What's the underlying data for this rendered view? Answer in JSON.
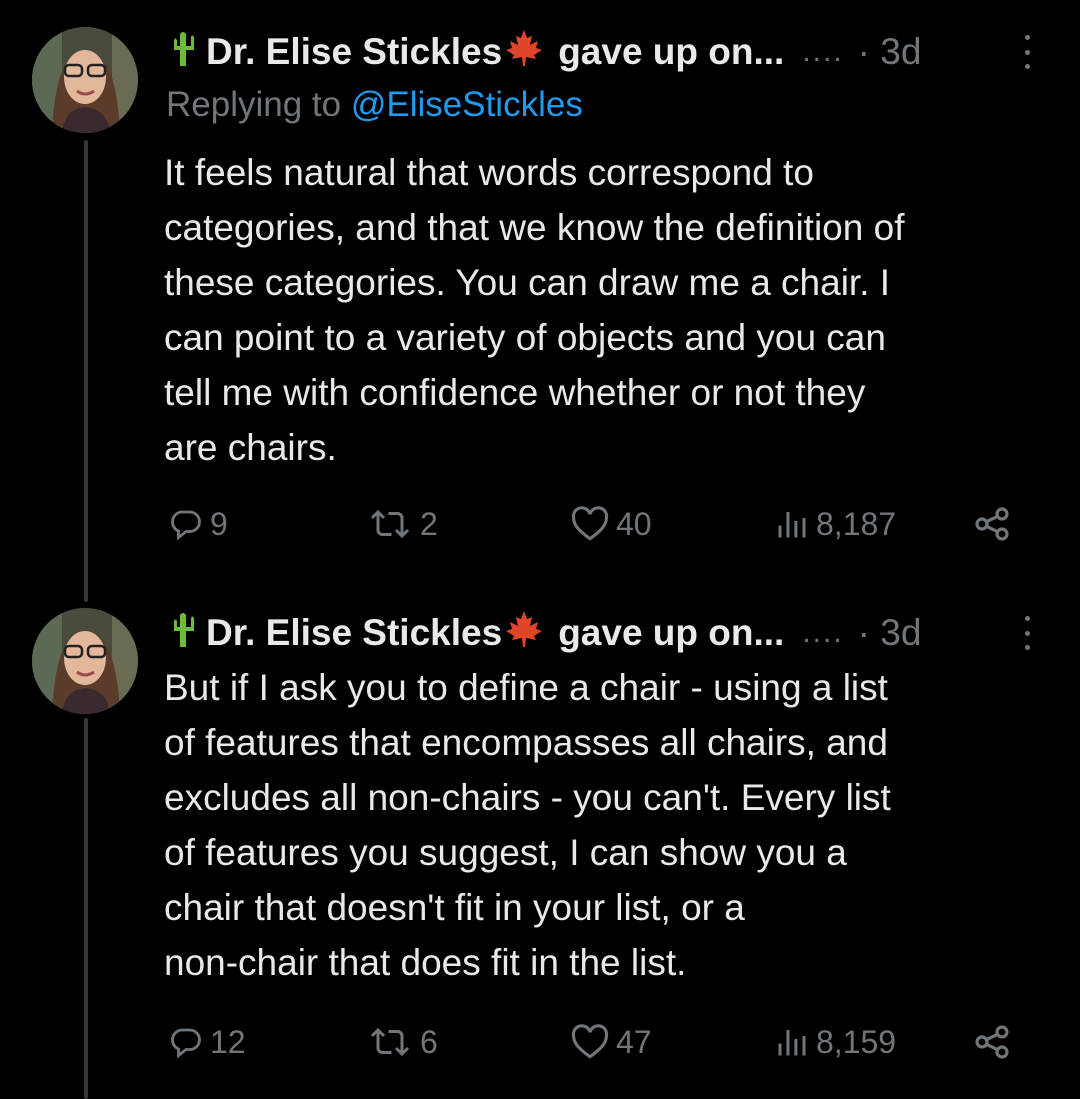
{
  "tweets": [
    {
      "author": {
        "name": "Dr. Elise Stickles",
        "prefix_emoji": "cactus-icon",
        "suffix_emoji": "maple-leaf-icon",
        "suffix_text": "gave up on...",
        "ellipsis": "....",
        "time": "· 3d"
      },
      "reply_label": "Replying to",
      "reply_handle": "@EliseStickles",
      "text": "It feels natural that words correspond to\ncategories, and that we know the definition of\nthese categories. You can draw me a chair. I\ncan point to a variety of objects and you can\ntell me with confidence whether or not they\nare chairs.",
      "stats": {
        "replies": "9",
        "reposts": "2",
        "likes": "40",
        "views": "8,187"
      }
    },
    {
      "author": {
        "name": "Dr. Elise Stickles",
        "prefix_emoji": "cactus-icon",
        "suffix_emoji": "maple-leaf-icon",
        "suffix_text": "gave up on...",
        "ellipsis": "....",
        "time": "· 3d"
      },
      "text": "But if I ask you to define a chair - using a list\nof features that encompasses all chairs, and\nexcludes all non-chairs - you can't. Every list\nof features you suggest, I can show you a\nchair that doesn't fit in your list, or a\nnon-chair that does fit in the list.",
      "stats": {
        "replies": "12",
        "reposts": "6",
        "likes": "47",
        "views": "8,159"
      }
    }
  ],
  "colors": {
    "background": "#000000",
    "text": "#e7e9ea",
    "muted": "#71767b",
    "link": "#1d9bf0",
    "thread_line": "#333639"
  }
}
